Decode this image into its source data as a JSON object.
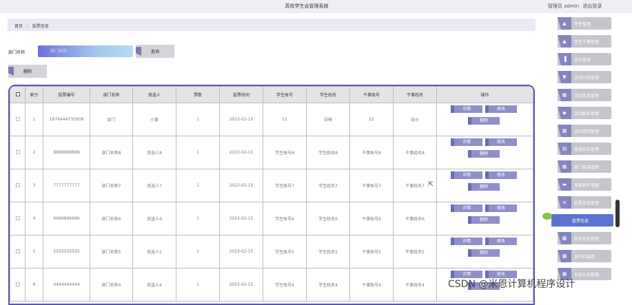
{
  "app": {
    "title": "高校学生会管理系统",
    "user_label": "管理员 admin",
    "logout_label": "退出登录"
  },
  "breadcrumb": {
    "home": "首页",
    "sep": "∷",
    "current": "投票信息"
  },
  "search": {
    "label": "部门名称",
    "placeholder": "部门名称",
    "query_label": "查询"
  },
  "toolbar": {
    "delete_label": "删除"
  },
  "table": {
    "headers": [
      "",
      "索引",
      "投票编号",
      "部门名称",
      "竞选人",
      "票数",
      "投票时间",
      "学生账号",
      "学生姓名",
      "干事账号",
      "干事姓名",
      "操作"
    ],
    "actions": {
      "detail": "详情",
      "edit": "修改",
      "delete": "删除"
    },
    "rows": [
      {
        "index": "1",
        "vote_no": "1676444735908",
        "dept": "部门",
        "candidate": "小黄",
        "votes": "1",
        "time": "2023-02-15",
        "stu_acc": "11",
        "stu_name": "张梅",
        "staff_acc": "22",
        "staff_name": "张元"
      },
      {
        "index": "2",
        "vote_no": "8888888888",
        "dept": "部门名称8",
        "candidate": "竞选人8",
        "votes": "1",
        "time": "2023-02-15",
        "stu_acc": "学生账号8",
        "stu_name": "学生姓名8",
        "staff_acc": "干事账号8",
        "staff_name": "干事姓名8"
      },
      {
        "index": "3",
        "vote_no": "7777777777",
        "dept": "部门名称7",
        "candidate": "竞选人7",
        "votes": "1",
        "time": "2023-02-15",
        "stu_acc": "学生账号7",
        "stu_name": "学生姓名7",
        "staff_acc": "干事账号7",
        "staff_name": "干事姓名7"
      },
      {
        "index": "4",
        "vote_no": "6666666666",
        "dept": "部门名称6",
        "candidate": "竞选人6",
        "votes": "1",
        "time": "2023-02-15",
        "stu_acc": "学生账号6",
        "stu_name": "学生姓名6",
        "staff_acc": "干事账号6",
        "staff_name": "干事姓名6"
      },
      {
        "index": "5",
        "vote_no": "5555555555",
        "dept": "部门名称5",
        "candidate": "竞选人5",
        "votes": "1",
        "time": "2023-02-15",
        "stu_acc": "学生账号5",
        "stu_name": "学生姓名5",
        "staff_acc": "干事账号5",
        "staff_name": "干事姓名5"
      },
      {
        "index": "6",
        "vote_no": "4444444444",
        "dept": "部门名称4",
        "candidate": "竞选人4",
        "votes": "1",
        "time": "2023-02-15",
        "stu_acc": "学生账号4",
        "stu_name": "学生姓名4",
        "staff_acc": "干事账号4",
        "staff_name": "干事姓名4"
      }
    ]
  },
  "sidebar": {
    "items": [
      {
        "label": "学生管理",
        "icon": "person-icon"
      },
      {
        "label": "学生干事管理",
        "icon": "person-icon"
      },
      {
        "label": "会员管理",
        "icon": "chart-icon"
      },
      {
        "label": "活动分类管理",
        "icon": "filter-icon"
      },
      {
        "label": "活动信息管理",
        "icon": "grid-icon"
      },
      {
        "label": "活动报名管理",
        "icon": "home-icon"
      },
      {
        "label": "活动签到管理",
        "icon": "grid-icon"
      },
      {
        "label": "竞选职位管理",
        "icon": "doc-icon"
      },
      {
        "label": "部门竞选管理",
        "icon": "grid-icon"
      },
      {
        "label": "竞选报名管理",
        "icon": "chat-icon"
      },
      {
        "label": "投票信息管理",
        "icon": "list-icon"
      },
      {
        "label": "投票信息",
        "icon": "",
        "active": true
      },
      {
        "label": "财务信息管理",
        "icon": "grid-icon"
      },
      {
        "label": "宣传栏管理",
        "icon": "grid-icon"
      },
      {
        "label": "系统公告管理",
        "icon": "grid-icon"
      }
    ]
  },
  "watermark": "CSDN @米恩计算机程序设计"
}
